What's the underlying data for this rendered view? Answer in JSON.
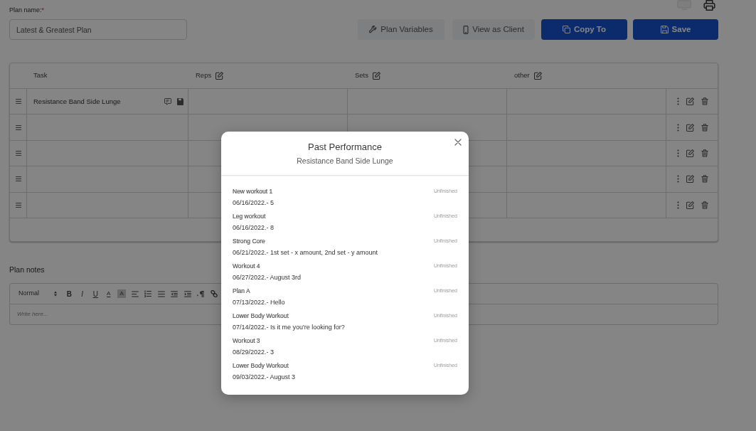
{
  "plan_name": {
    "label": "Plan name:",
    "required_mark": "*",
    "value": "Latest & Greatest Plan"
  },
  "actions": [
    {
      "label": "Plan Variables",
      "kind": "light"
    },
    {
      "label": "View as Client",
      "kind": "light"
    },
    {
      "label": "Copy To",
      "kind": "primary"
    },
    {
      "label": "Save",
      "kind": "primary"
    }
  ],
  "table": {
    "columns": [
      {
        "label": "Task",
        "editable": false
      },
      {
        "label": "Reps",
        "editable": true
      },
      {
        "label": "Sets",
        "editable": true
      },
      {
        "label": "other",
        "editable": true
      }
    ],
    "rows": [
      {
        "task": "Resistance Band Side Lunge"
      },
      {},
      {},
      {},
      {}
    ]
  },
  "notes": {
    "label": "Plan notes",
    "format": "Normal",
    "toolbar": [
      {
        "kind": "bold",
        "label": "B"
      },
      {
        "kind": "italic",
        "label": "I"
      },
      {
        "kind": "underline",
        "label": "U"
      },
      {
        "kind": "color",
        "label": "A"
      },
      {
        "kind": "highlight",
        "label": "A"
      },
      {
        "kind": "align"
      },
      {
        "kind": "ordered"
      },
      {
        "kind": "bullet"
      },
      {
        "kind": "outdent"
      },
      {
        "kind": "indent"
      },
      {
        "kind": "direction"
      },
      {
        "kind": "link"
      }
    ],
    "placeholder": "Write here..."
  },
  "modal": {
    "title": "Past Performance",
    "subtitle": "Resistance Band Side Lunge",
    "entries": [
      {
        "workout": "New workout 1",
        "status": "Unfinished",
        "result": "06/16/2022.- 5"
      },
      {
        "workout": "Leg workout",
        "status": "Unfinished",
        "result": "06/16/2022.- 8"
      },
      {
        "workout": "Strong Core",
        "status": "Unfinished",
        "result": "06/21/2022.- 1st set - x amount, 2nd set - y amount"
      },
      {
        "workout": "Workout 4",
        "status": "Unfinished",
        "result": "06/27/2022.- August 3rd"
      },
      {
        "workout": "Plan A",
        "status": "Unfinished",
        "result": "07/13/2022.- Hello"
      },
      {
        "workout": "Lower Body Workout",
        "status": "Unfinished",
        "result": "07/14/2022.- Is it me you're looking for?"
      },
      {
        "workout": "Workout 3",
        "status": "Unfinished",
        "result": "08/29/2022.- 3"
      },
      {
        "workout": "Lower Body Workout",
        "status": "Unfinished",
        "result": "09/03/2022.- August 3"
      }
    ]
  }
}
